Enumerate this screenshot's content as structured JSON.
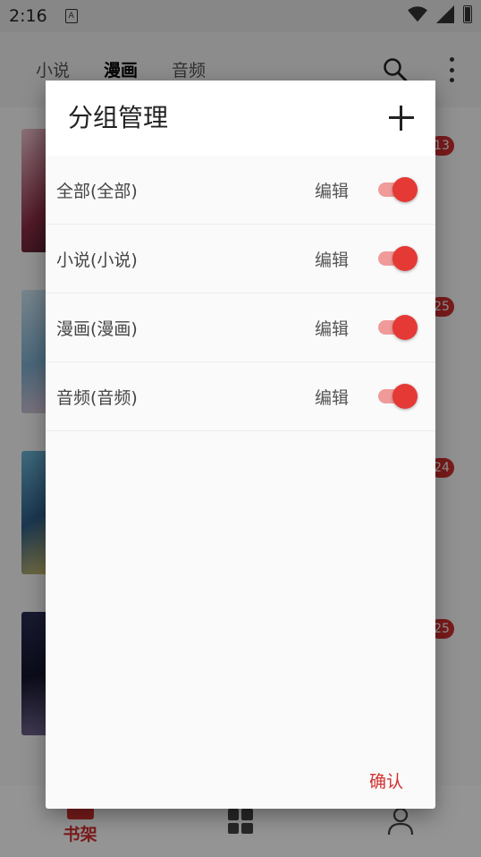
{
  "status_bar": {
    "time": "2:16",
    "notification_icon": "a11y-a-icon"
  },
  "header": {
    "tabs": [
      {
        "label": "小说",
        "active": false
      },
      {
        "label": "漫画",
        "active": true
      },
      {
        "label": "音频",
        "active": false
      }
    ]
  },
  "background": {
    "badges": [
      "13",
      "25",
      "24",
      "25"
    ]
  },
  "bottom_nav": {
    "items": [
      {
        "label": "书架",
        "icon": "bookshelf-icon",
        "active": true
      },
      {
        "label": "",
        "icon": "grid-icon",
        "active": false
      },
      {
        "label": "",
        "icon": "person-icon",
        "active": false
      }
    ]
  },
  "dialog": {
    "title": "分组管理",
    "add_icon": "plus-icon",
    "groups": [
      {
        "name": "全部(全部)",
        "edit_label": "编辑",
        "enabled": true
      },
      {
        "name": "小说(小说)",
        "edit_label": "编辑",
        "enabled": true
      },
      {
        "name": "漫画(漫画)",
        "edit_label": "编辑",
        "enabled": true
      },
      {
        "name": "音频(音频)",
        "edit_label": "编辑",
        "enabled": true
      }
    ],
    "confirm_label": "确认"
  },
  "colors": {
    "accent": "#d32f2f",
    "toggle_thumb": "#e53935",
    "toggle_track": "#f09a9a"
  }
}
